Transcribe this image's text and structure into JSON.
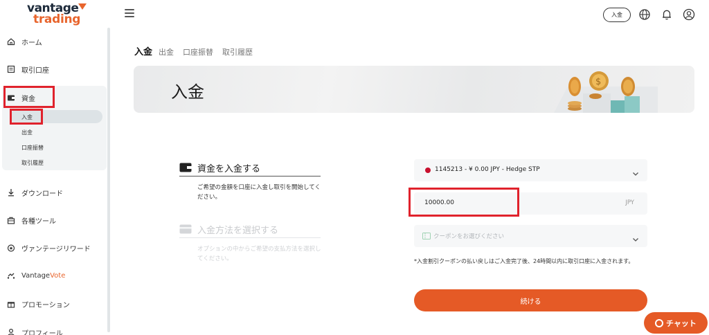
{
  "logo": {
    "line1": "vantage",
    "line2": "trading"
  },
  "sidebar": {
    "items": [
      {
        "label": "ホーム",
        "icon": "home-icon"
      },
      {
        "label": "取引口座",
        "icon": "account-icon"
      },
      {
        "label": "資金",
        "icon": "wallet-icon"
      },
      {
        "label": "ダウンロード",
        "icon": "download-icon"
      },
      {
        "label": "各種ツール",
        "icon": "tools-icon"
      },
      {
        "label": "ヴァンテージリワード",
        "icon": "reward-icon"
      },
      {
        "label": "Vantage ",
        "label_accent": "Vote",
        "icon": "vote-icon"
      },
      {
        "label": "プロモーション",
        "icon": "gift-icon"
      },
      {
        "label": "プロフィール",
        "icon": "user-icon"
      }
    ],
    "fund_sub": [
      "入金",
      "出金",
      "口座振替",
      "取引履歴"
    ]
  },
  "header": {
    "deposit_label": "入金",
    "icons": [
      "globe-icon",
      "bell-icon",
      "profile-icon"
    ]
  },
  "tabs": [
    "入金",
    "出金",
    "口座振替",
    "取引履歴"
  ],
  "banner": {
    "title": "入金"
  },
  "steps": [
    {
      "title": "資金を入金する",
      "desc": "ご希望の金額を口座に入金し取引を開始してください。"
    },
    {
      "title": "入金方法を選択する",
      "desc": "オプションの中からご希望の支払方法を選択してください。"
    }
  ],
  "form": {
    "account": "1145213 - ¥ 0.00 JPY - Hedge STP",
    "amount": "10000.00",
    "currency": "JPY",
    "coupon_placeholder": "クーポンをお選びください",
    "note": "*入金割引クーポンの払い戻しはご入金完了後、24時間以内に取引口座に入金されます。",
    "continue_label": "続ける"
  },
  "chat": {
    "label": "チャット"
  },
  "colors": {
    "accent": "#e55a26",
    "highlight": "#e0222c",
    "logo_dark": "#1d2a3a"
  }
}
